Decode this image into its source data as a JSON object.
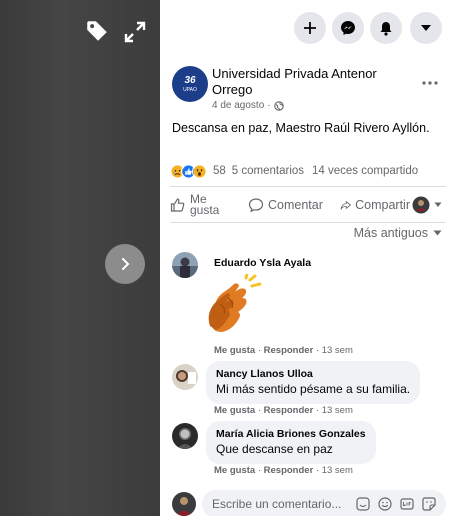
{
  "viewer": {
    "icons": [
      "tag-icon",
      "expand-icon",
      "chevron-right-icon"
    ]
  },
  "topnav": {
    "icons": [
      "plus-icon",
      "messenger-icon",
      "bell-icon",
      "caret-down-icon"
    ]
  },
  "post": {
    "page_name": "Universidad Privada Antenor Orrego",
    "avatar_text_top": "36",
    "avatar_text_bottom": "UPAO",
    "date": "4 de agosto",
    "privacy_sep": "·",
    "text": "Descansa en paz, Maestro Raúl Rivero Ayllón.",
    "reaction_count": "58",
    "comments_count": "5 comentarios",
    "shares_count": "14 veces compartido",
    "reaction_colors": {
      "sad": "#f7b125",
      "like": "#1877f2",
      "wow": "#f7b125"
    }
  },
  "actions": {
    "like_line1": "Me",
    "like_line2": "gusta",
    "comment": "Comentar",
    "share": "Compartir"
  },
  "sort": {
    "label": "Más antiguos"
  },
  "comments": [
    {
      "author": "Eduardo Ysla Ayala",
      "text": "",
      "like": "Me gusta",
      "reply": "Responder",
      "time": "13 sem"
    },
    {
      "author": "Nancy Llanos Ulloa",
      "text": "Mi más sentido pésame a su familia.",
      "like": "Me gusta",
      "reply": "Responder",
      "time": "13 sem"
    },
    {
      "author": "María Alicia Briones Gonzales",
      "text": "Que descanse en paz",
      "like": "Me gusta",
      "reply": "Responder",
      "time": "13 sem"
    }
  ],
  "meta_sep": " · ",
  "composer": {
    "placeholder": "Escribe un comentario...",
    "icons": [
      "sticker-icon",
      "emoji-icon",
      "gif-icon",
      "sticker-smile-icon"
    ]
  }
}
